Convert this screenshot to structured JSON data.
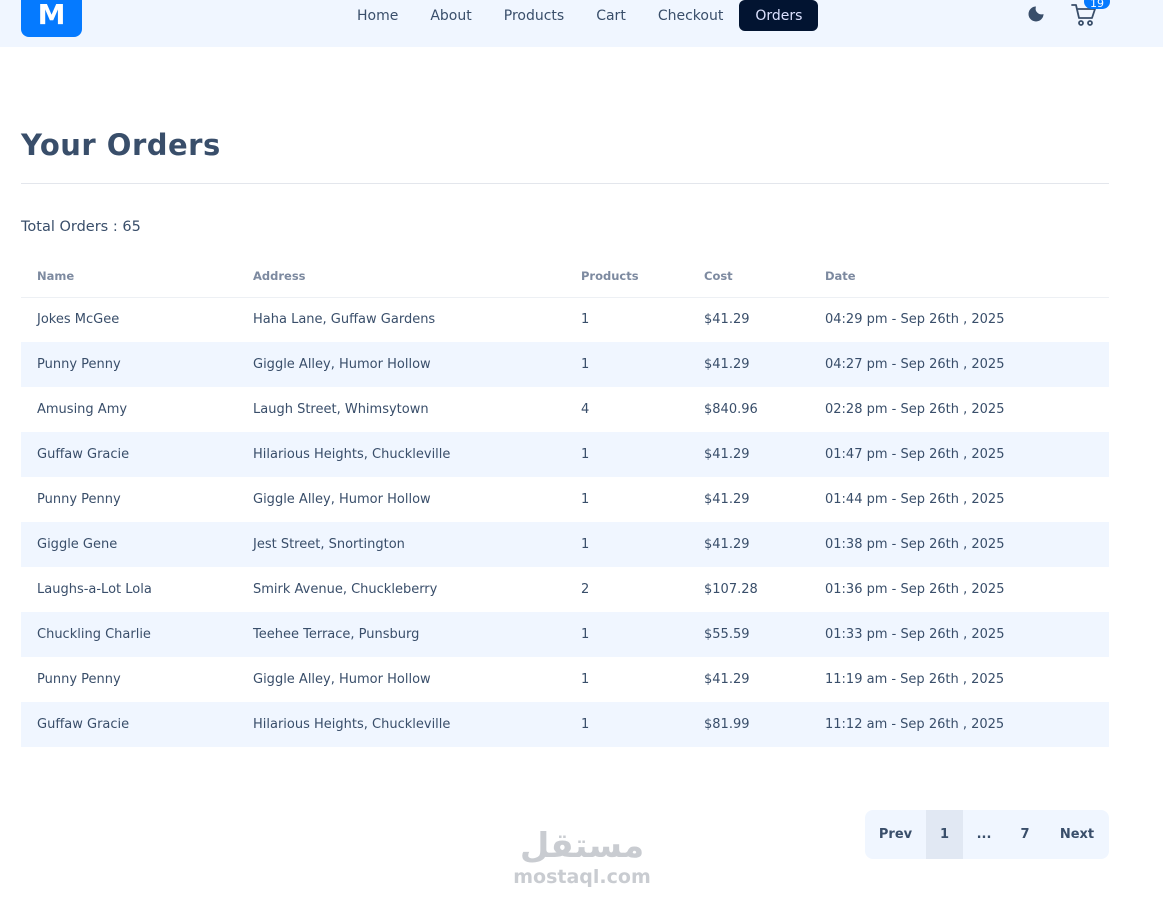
{
  "navbar": {
    "logo_letter": "M",
    "links": [
      "Home",
      "About",
      "Products",
      "Cart",
      "Checkout",
      "Orders"
    ],
    "active_link": "Orders",
    "cart_count": "19",
    "theme_icon": "moon-icon",
    "cart_icon": "shopping-cart-icon"
  },
  "page": {
    "title": "Your Orders",
    "total_orders": "Total Orders : 65"
  },
  "table": {
    "headers": [
      "Name",
      "Address",
      "Products",
      "Cost",
      "Date"
    ],
    "rows": [
      [
        "Jokes McGee",
        "Haha Lane, Guffaw Gardens",
        "1",
        "$41.29",
        "04:29 pm - Sep 26th , 2025"
      ],
      [
        "Punny Penny",
        "Giggle Alley, Humor Hollow",
        "1",
        "$41.29",
        "04:27 pm - Sep 26th , 2025"
      ],
      [
        "Amusing Amy",
        "Laugh Street, Whimsytown",
        "4",
        "$840.96",
        "02:28 pm - Sep 26th , 2025"
      ],
      [
        "Guffaw Gracie",
        "Hilarious Heights, Chuckleville",
        "1",
        "$41.29",
        "01:47 pm - Sep 26th , 2025"
      ],
      [
        "Punny Penny",
        "Giggle Alley, Humor Hollow",
        "1",
        "$41.29",
        "01:44 pm - Sep 26th , 2025"
      ],
      [
        "Giggle Gene",
        "Jest Street, Snortington",
        "1",
        "$41.29",
        "01:38 pm - Sep 26th , 2025"
      ],
      [
        "Laughs-a-Lot Lola",
        "Smirk Avenue, Chuckleberry",
        "2",
        "$107.28",
        "01:36 pm - Sep 26th , 2025"
      ],
      [
        "Chuckling Charlie",
        "Teehee Terrace, Punsburg",
        "1",
        "$55.59",
        "01:33 pm - Sep 26th , 2025"
      ],
      [
        "Punny Penny",
        "Giggle Alley, Humor Hollow",
        "1",
        "$41.29",
        "11:19 am - Sep 26th , 2025"
      ],
      [
        "Guffaw Gracie",
        "Hilarious Heights, Chuckleville",
        "1",
        "$81.99",
        "11:12 am - Sep 26th , 2025"
      ]
    ]
  },
  "pagination": {
    "prev": "Prev",
    "pages": [
      "1",
      "...",
      "7"
    ],
    "current": "1",
    "next": "Next"
  },
  "watermark": {
    "arabic": "مستقل",
    "latin": "mostaql.com"
  },
  "colors": {
    "primary": "#057aff",
    "nav_bg": "#f0f6ff",
    "active_nav_bg": "#021431",
    "text": "#394e6a"
  }
}
